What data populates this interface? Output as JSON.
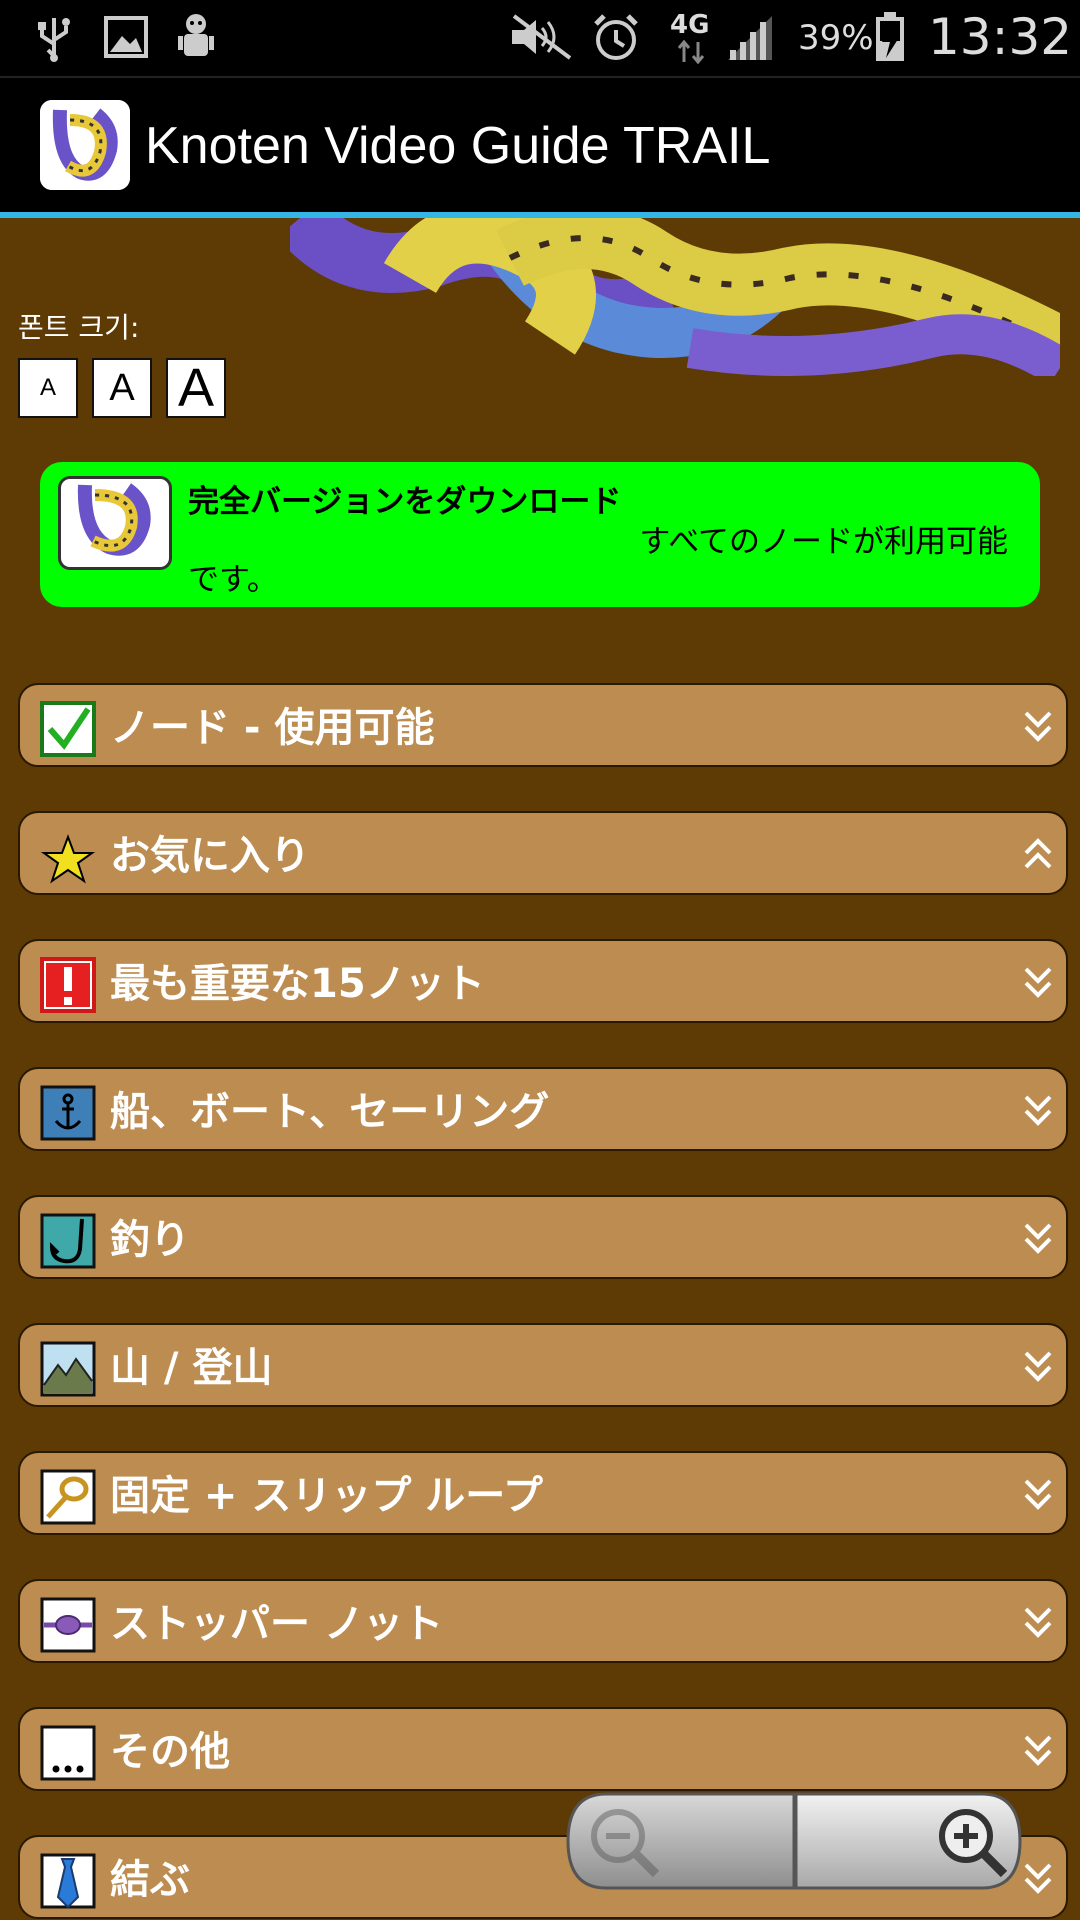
{
  "status_bar": {
    "battery": "39%",
    "time": "13:32",
    "network": "4G",
    "icons": [
      "usb-icon",
      "image-icon",
      "android-debug-icon",
      "mute-icon",
      "alarm-icon",
      "network-4g-icon",
      "signal-icon",
      "battery-charging-icon"
    ]
  },
  "app_bar": {
    "title": "Knoten Video Guide TRAIL",
    "icon": "knot-app-icon"
  },
  "font_size": {
    "label": "폰트 크기:",
    "buttons": [
      "A",
      "A",
      "A"
    ]
  },
  "promo": {
    "title": "完全バージョンをダウンロード",
    "subtitle": "すべてのノードが利用可能",
    "subtitle_cont": "です。",
    "bg_color": "#00ff00"
  },
  "categories": [
    {
      "label": "ノード - 使用可能",
      "icon": "checkbox-checked-icon",
      "state": "collapsed"
    },
    {
      "label": "お気に入り",
      "icon": "star-icon",
      "state": "expanded"
    },
    {
      "label": "最も重要な15ノット",
      "icon": "exclamation-icon",
      "state": "collapsed"
    },
    {
      "label": "船、ボート、セーリング",
      "icon": "anchor-icon",
      "state": "collapsed"
    },
    {
      "label": "釣り",
      "icon": "fishing-hook-icon",
      "state": "collapsed"
    },
    {
      "label": "山 / 登山",
      "icon": "mountain-icon",
      "state": "collapsed"
    },
    {
      "label": "固定 + スリップ ループ",
      "icon": "loop-knot-icon",
      "state": "collapsed"
    },
    {
      "label": "ストッパー ノット",
      "icon": "stopper-knot-icon",
      "state": "collapsed"
    },
    {
      "label": "その他",
      "icon": "ellipsis-icon",
      "state": "collapsed"
    },
    {
      "label": "結ぶ",
      "icon": "tie-icon",
      "state": "collapsed"
    }
  ],
  "zoom_controls": {
    "zoom_out": "zoom-out-icon",
    "zoom_in": "zoom-in-icon"
  },
  "colors": {
    "background": "#5e3a04",
    "category_bg": "#bc8c51",
    "accent": "#33b5e5"
  }
}
